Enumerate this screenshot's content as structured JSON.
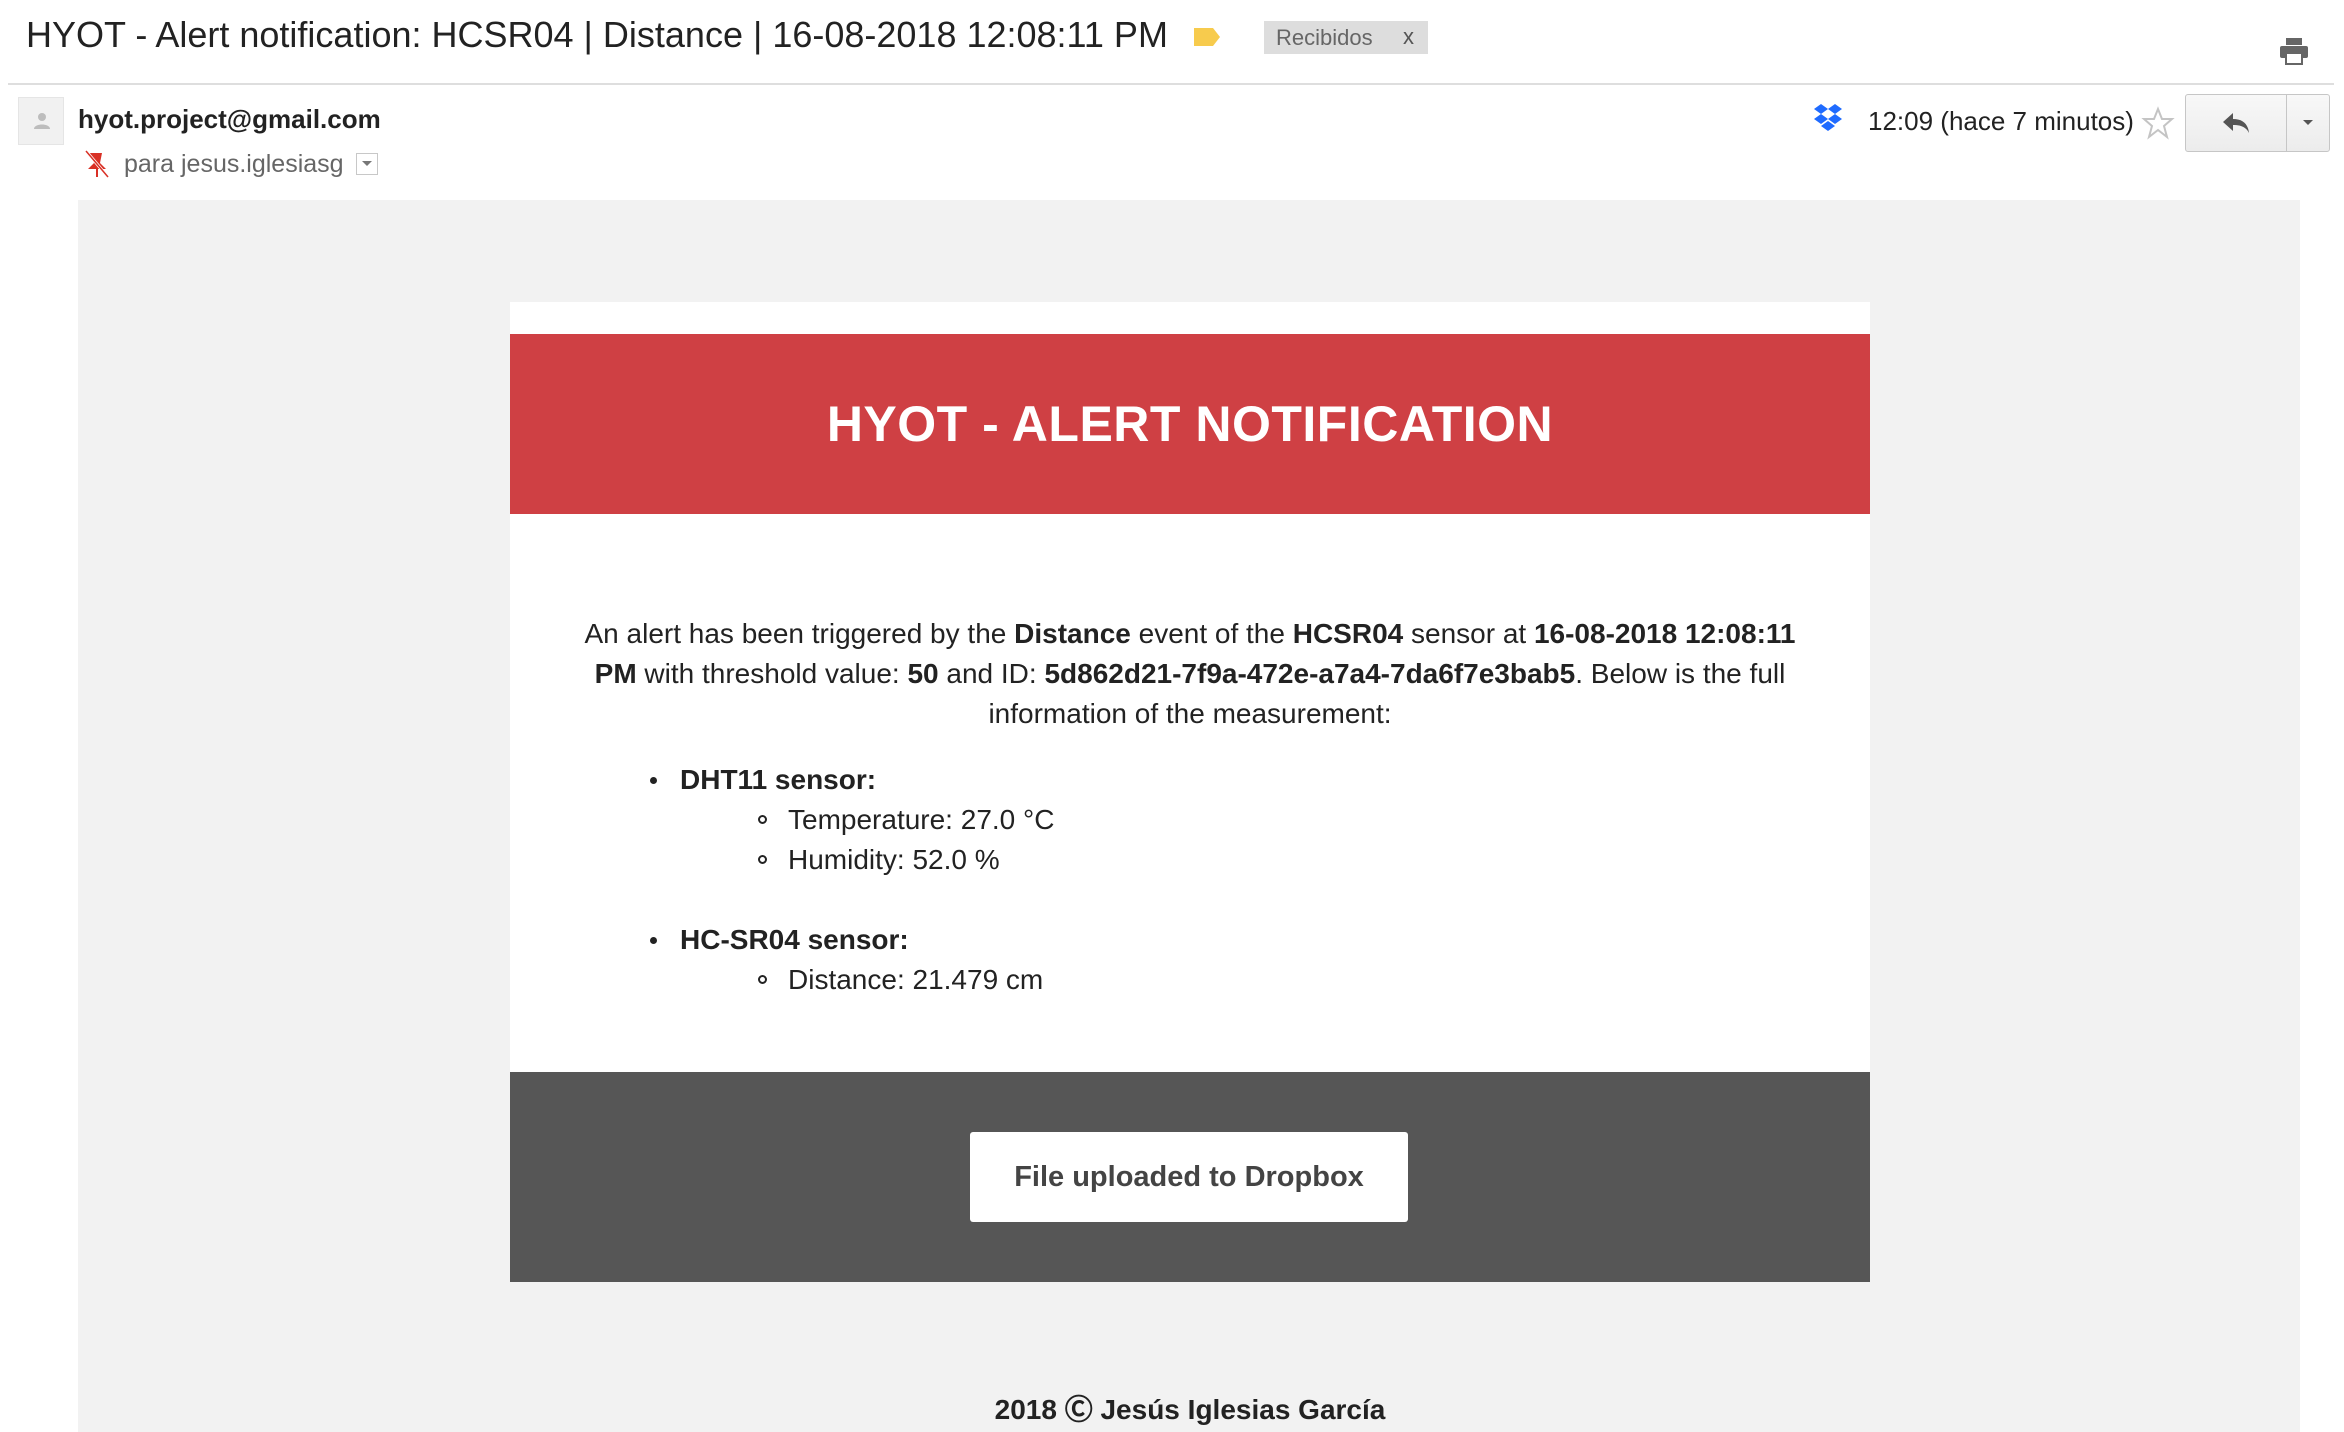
{
  "header": {
    "subject": "HYOT - Alert notification: HCSR04 | Distance | 16-08-2018 12:08:11 PM",
    "label_chip": "Recibidos",
    "label_close": "x",
    "label_tag_color": "#f7cb4d",
    "print_icon": "print-icon"
  },
  "message": {
    "sender": "hyot.project@gmail.com",
    "recipient": "para jesus.iglesiasg",
    "time": "12:09 (hace 7 minutos)",
    "icons": [
      "avatar-icon",
      "pin-icon",
      "dropbox-icon",
      "star-icon",
      "reply-icon",
      "chevron-down-icon"
    ]
  },
  "email": {
    "banner_title": "HYOT - ALERT NOTIFICATION",
    "banner_color": "#cf4044",
    "alert": {
      "p1": "An alert has been triggered by the ",
      "event": "Distance",
      "p2": " event of the ",
      "sensor": "HCSR04",
      "p3": " sensor at ",
      "datetime": "16-08-2018 12:08:11 PM",
      "p4": " with threshold value: ",
      "threshold": "50",
      "p5": " and ID: ",
      "id": "5d862d21-7f9a-472e-a7a4-7da6f7e3bab5",
      "p6": ". Below is the full information of the measurement:"
    },
    "sensors": [
      {
        "name": "DHT11 sensor:",
        "readings": [
          "Temperature: 27.0 °C",
          "Humidity: 52.0 %"
        ]
      },
      {
        "name": "HC-SR04 sensor:",
        "readings": [
          "Distance: 21.479 cm"
        ]
      }
    ],
    "button_label": "File uploaded to Dropbox",
    "footer_color": "#565656",
    "copyright": "2018 Ⓒ Jesús Iglesias García"
  }
}
